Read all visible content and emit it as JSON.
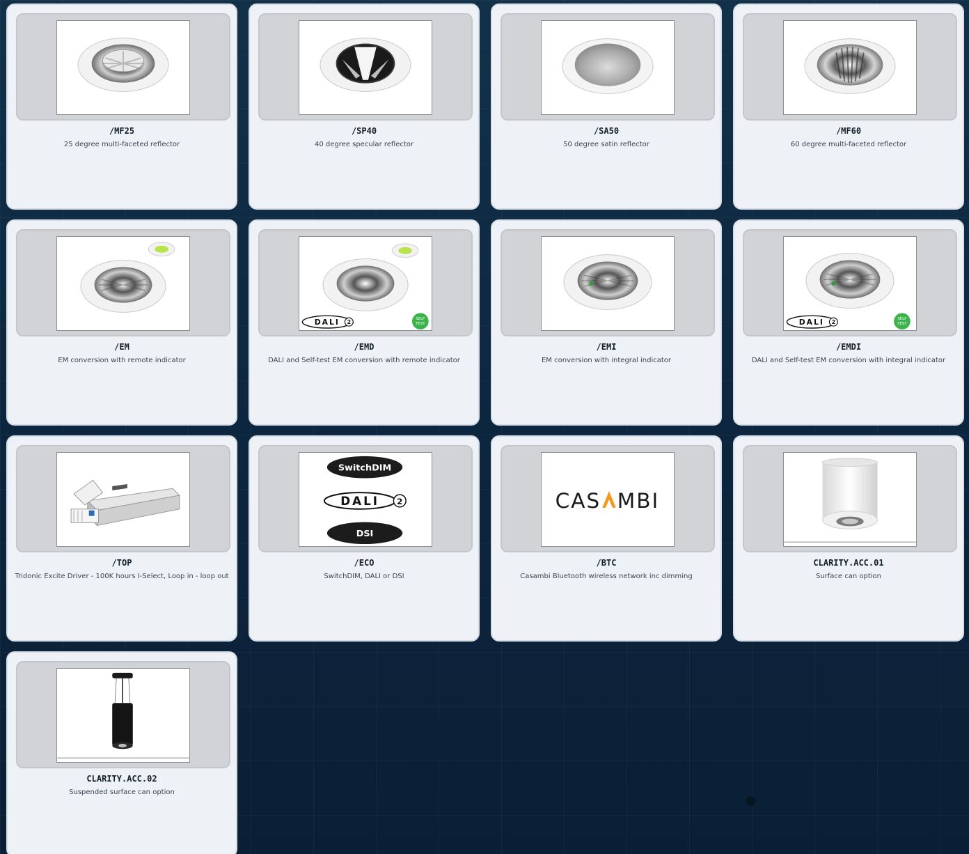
{
  "products": [
    {
      "code": "/MF25",
      "description": "25 degree multi-faceted reflector",
      "image": "downlight-multifaceted-reflector"
    },
    {
      "code": "/SP40",
      "description": "40 degree specular reflector",
      "image": "downlight-specular-reflector"
    },
    {
      "code": "/SA50",
      "description": "50 degree satin reflector",
      "image": "downlight-satin-reflector"
    },
    {
      "code": "/MF60",
      "description": "60 degree multi-faceted reflector",
      "image": "downlight-multifaceted-reflector"
    },
    {
      "code": "/EM",
      "description": "EM conversion with remote indicator",
      "image": "downlight-em-remote-indicator"
    },
    {
      "code": "/EMD",
      "description": "DALI and Self-test EM conversion with remote indicator",
      "image": "downlight-em-remote-dali-selftest"
    },
    {
      "code": "/EMI",
      "description": "EM conversion with integral indicator",
      "image": "downlight-em-integral-indicator"
    },
    {
      "code": "/EMDI",
      "description": "DALI and Self-test EM conversion with integral indicator",
      "image": "downlight-em-integral-dali-selftest"
    },
    {
      "code": "/TOP",
      "description": "Tridonic Excite Driver - 100K hours I-Select, Loop in - loop out",
      "image": "led-driver"
    },
    {
      "code": "/ECO",
      "description": "SwitchDIM, DALI or DSI",
      "image": "control-protocol-logos"
    },
    {
      "code": "/BTC",
      "description": "Casambi Bluetooth wireless network inc dimming",
      "image": "casambi-logo"
    },
    {
      "code": "CLARITY.ACC.01",
      "description": "Surface can option",
      "image": "surface-can"
    },
    {
      "code": "CLARITY.ACC.02",
      "description": "Suspended surface can option",
      "image": "suspended-can"
    }
  ],
  "logo_text": {
    "switchdim": "SwitchDIM",
    "dali": "DALI",
    "dali_version": "2",
    "dsi": "DSI",
    "casambi_left": "CAS",
    "casambi_right": "MBI",
    "self_test_top": "SELF",
    "self_test_bottom": "TEST"
  },
  "colors": {
    "background": "#0d2740",
    "card": "#eef1f5",
    "thumb": "#d2d3d6",
    "indicator_green": "#b9e34a",
    "self_test_badge": "#3cb44b",
    "casambi_accent": "#f39a1e"
  }
}
